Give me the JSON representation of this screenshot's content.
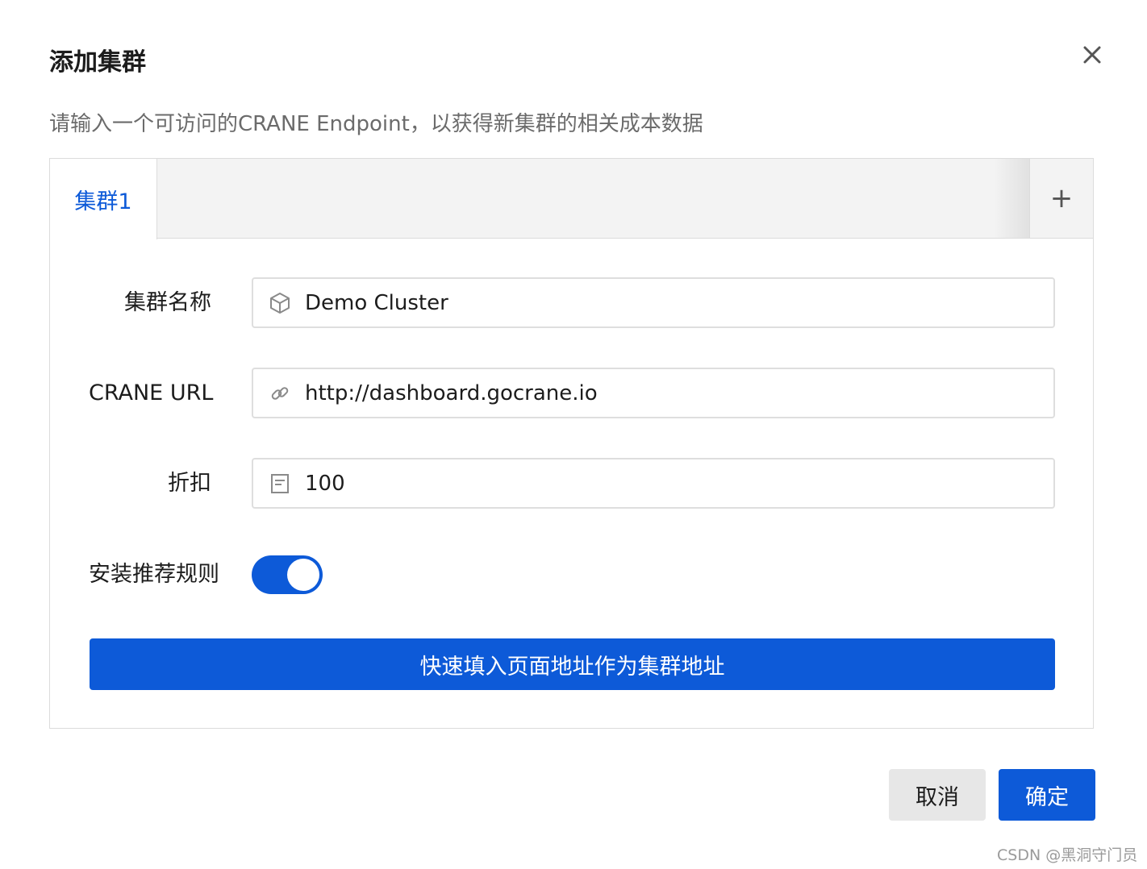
{
  "dialog": {
    "title": "添加集群",
    "close_icon": "close-icon",
    "description": "请输入一个可访问的CRANE Endpoint，以获得新集群的相关成本数据"
  },
  "tabs": {
    "items": [
      {
        "label": "集群1",
        "active": true
      }
    ],
    "add_label": "+"
  },
  "form": {
    "cluster_name": {
      "label": "集群名称",
      "value": "Demo Cluster",
      "icon": "cube-icon"
    },
    "crane_url": {
      "label": "CRANE URL",
      "value": "http://dashboard.gocrane.io",
      "icon": "link-icon"
    },
    "discount": {
      "label": "折扣",
      "value": "100",
      "icon": "document-icon"
    },
    "install_rules": {
      "label": "安装推荐规则",
      "checked": true
    },
    "fill_button": "快速填入页面地址作为集群地址"
  },
  "footer": {
    "cancel_label": "取消",
    "confirm_label": "确定"
  },
  "watermark": "CSDN @黑洞守门员",
  "colors": {
    "primary": "#0d5ad8",
    "tab_bar": "#f3f3f3",
    "border": "#dcdcdc",
    "cancel_bg": "#e7e7e7"
  }
}
